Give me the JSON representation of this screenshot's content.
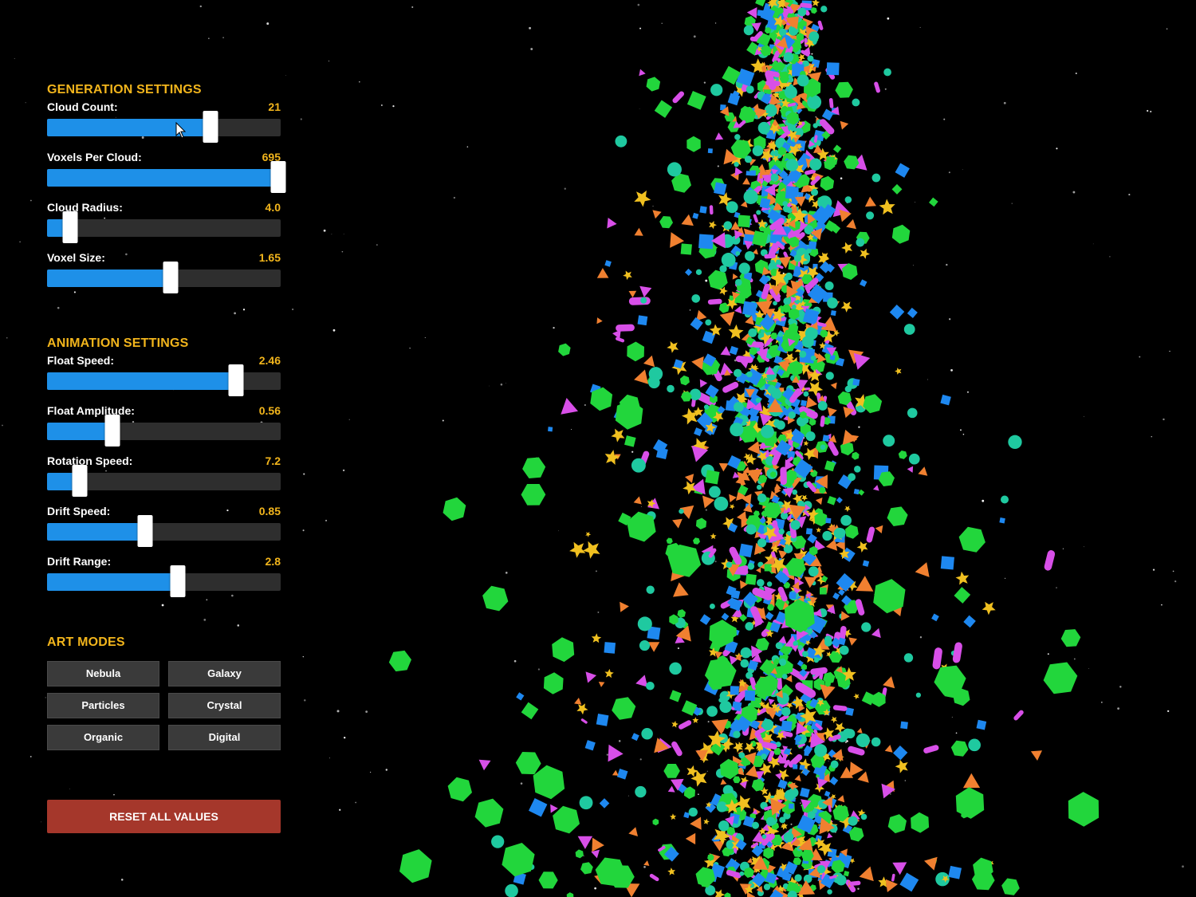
{
  "generation": {
    "title": "GENERATION SETTINGS",
    "sliders": [
      {
        "label": "Cloud Count:",
        "value": "21",
        "fraction": 0.7
      },
      {
        "label": "Voxels Per Cloud:",
        "value": "695",
        "fraction": 0.99
      },
      {
        "label": "Cloud Radius:",
        "value": "4.0",
        "fraction": 0.1
      },
      {
        "label": "Voxel Size:",
        "value": "1.65",
        "fraction": 0.53
      }
    ]
  },
  "animation": {
    "title": "ANIMATION SETTINGS",
    "sliders": [
      {
        "label": "Float Speed:",
        "value": "2.46",
        "fraction": 0.81
      },
      {
        "label": "Float Amplitude:",
        "value": "0.56",
        "fraction": 0.28
      },
      {
        "label": "Rotation Speed:",
        "value": "7.2",
        "fraction": 0.14
      },
      {
        "label": "Drift Speed:",
        "value": "0.85",
        "fraction": 0.42
      },
      {
        "label": "Drift Range:",
        "value": "2.8",
        "fraction": 0.56
      }
    ]
  },
  "art_modes": {
    "title": "ART MODES",
    "buttons": [
      "Nebula",
      "Galaxy",
      "Particles",
      "Crystal",
      "Organic",
      "Digital"
    ]
  },
  "reset_label": "RESET ALL VALUES",
  "colors": {
    "accent": "#f2b51c",
    "slider_fill": "#1e90e8",
    "reset": "#a5372b",
    "voxel_green": "#22d63c",
    "voxel_magenta": "#d84fe8",
    "voxel_blue": "#1e88f0",
    "voxel_teal": "#1fc9a0",
    "voxel_gold": "#f0c020",
    "voxel_orange": "#f08030"
  }
}
